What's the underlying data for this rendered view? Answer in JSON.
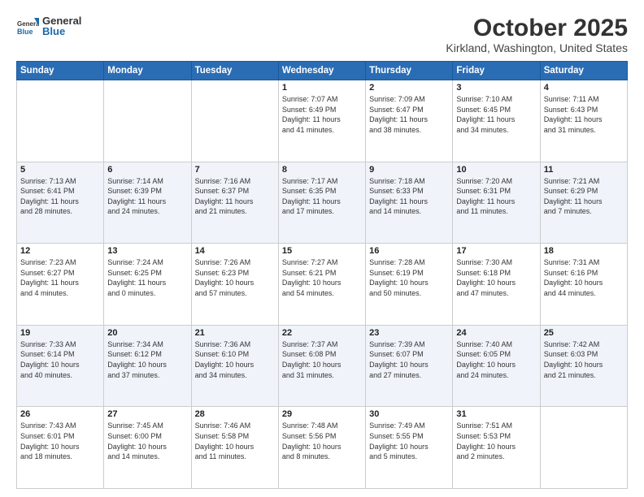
{
  "logo": {
    "general": "General",
    "blue": "Blue"
  },
  "title": "October 2025",
  "location": "Kirkland, Washington, United States",
  "days_of_week": [
    "Sunday",
    "Monday",
    "Tuesday",
    "Wednesday",
    "Thursday",
    "Friday",
    "Saturday"
  ],
  "weeks": [
    [
      {
        "day": "",
        "info": ""
      },
      {
        "day": "",
        "info": ""
      },
      {
        "day": "",
        "info": ""
      },
      {
        "day": "1",
        "info": "Sunrise: 7:07 AM\nSunset: 6:49 PM\nDaylight: 11 hours\nand 41 minutes."
      },
      {
        "day": "2",
        "info": "Sunrise: 7:09 AM\nSunset: 6:47 PM\nDaylight: 11 hours\nand 38 minutes."
      },
      {
        "day": "3",
        "info": "Sunrise: 7:10 AM\nSunset: 6:45 PM\nDaylight: 11 hours\nand 34 minutes."
      },
      {
        "day": "4",
        "info": "Sunrise: 7:11 AM\nSunset: 6:43 PM\nDaylight: 11 hours\nand 31 minutes."
      }
    ],
    [
      {
        "day": "5",
        "info": "Sunrise: 7:13 AM\nSunset: 6:41 PM\nDaylight: 11 hours\nand 28 minutes."
      },
      {
        "day": "6",
        "info": "Sunrise: 7:14 AM\nSunset: 6:39 PM\nDaylight: 11 hours\nand 24 minutes."
      },
      {
        "day": "7",
        "info": "Sunrise: 7:16 AM\nSunset: 6:37 PM\nDaylight: 11 hours\nand 21 minutes."
      },
      {
        "day": "8",
        "info": "Sunrise: 7:17 AM\nSunset: 6:35 PM\nDaylight: 11 hours\nand 17 minutes."
      },
      {
        "day": "9",
        "info": "Sunrise: 7:18 AM\nSunset: 6:33 PM\nDaylight: 11 hours\nand 14 minutes."
      },
      {
        "day": "10",
        "info": "Sunrise: 7:20 AM\nSunset: 6:31 PM\nDaylight: 11 hours\nand 11 minutes."
      },
      {
        "day": "11",
        "info": "Sunrise: 7:21 AM\nSunset: 6:29 PM\nDaylight: 11 hours\nand 7 minutes."
      }
    ],
    [
      {
        "day": "12",
        "info": "Sunrise: 7:23 AM\nSunset: 6:27 PM\nDaylight: 11 hours\nand 4 minutes."
      },
      {
        "day": "13",
        "info": "Sunrise: 7:24 AM\nSunset: 6:25 PM\nDaylight: 11 hours\nand 0 minutes."
      },
      {
        "day": "14",
        "info": "Sunrise: 7:26 AM\nSunset: 6:23 PM\nDaylight: 10 hours\nand 57 minutes."
      },
      {
        "day": "15",
        "info": "Sunrise: 7:27 AM\nSunset: 6:21 PM\nDaylight: 10 hours\nand 54 minutes."
      },
      {
        "day": "16",
        "info": "Sunrise: 7:28 AM\nSunset: 6:19 PM\nDaylight: 10 hours\nand 50 minutes."
      },
      {
        "day": "17",
        "info": "Sunrise: 7:30 AM\nSunset: 6:18 PM\nDaylight: 10 hours\nand 47 minutes."
      },
      {
        "day": "18",
        "info": "Sunrise: 7:31 AM\nSunset: 6:16 PM\nDaylight: 10 hours\nand 44 minutes."
      }
    ],
    [
      {
        "day": "19",
        "info": "Sunrise: 7:33 AM\nSunset: 6:14 PM\nDaylight: 10 hours\nand 40 minutes."
      },
      {
        "day": "20",
        "info": "Sunrise: 7:34 AM\nSunset: 6:12 PM\nDaylight: 10 hours\nand 37 minutes."
      },
      {
        "day": "21",
        "info": "Sunrise: 7:36 AM\nSunset: 6:10 PM\nDaylight: 10 hours\nand 34 minutes."
      },
      {
        "day": "22",
        "info": "Sunrise: 7:37 AM\nSunset: 6:08 PM\nDaylight: 10 hours\nand 31 minutes."
      },
      {
        "day": "23",
        "info": "Sunrise: 7:39 AM\nSunset: 6:07 PM\nDaylight: 10 hours\nand 27 minutes."
      },
      {
        "day": "24",
        "info": "Sunrise: 7:40 AM\nSunset: 6:05 PM\nDaylight: 10 hours\nand 24 minutes."
      },
      {
        "day": "25",
        "info": "Sunrise: 7:42 AM\nSunset: 6:03 PM\nDaylight: 10 hours\nand 21 minutes."
      }
    ],
    [
      {
        "day": "26",
        "info": "Sunrise: 7:43 AM\nSunset: 6:01 PM\nDaylight: 10 hours\nand 18 minutes."
      },
      {
        "day": "27",
        "info": "Sunrise: 7:45 AM\nSunset: 6:00 PM\nDaylight: 10 hours\nand 14 minutes."
      },
      {
        "day": "28",
        "info": "Sunrise: 7:46 AM\nSunset: 5:58 PM\nDaylight: 10 hours\nand 11 minutes."
      },
      {
        "day": "29",
        "info": "Sunrise: 7:48 AM\nSunset: 5:56 PM\nDaylight: 10 hours\nand 8 minutes."
      },
      {
        "day": "30",
        "info": "Sunrise: 7:49 AM\nSunset: 5:55 PM\nDaylight: 10 hours\nand 5 minutes."
      },
      {
        "day": "31",
        "info": "Sunrise: 7:51 AM\nSunset: 5:53 PM\nDaylight: 10 hours\nand 2 minutes."
      },
      {
        "day": "",
        "info": ""
      }
    ]
  ]
}
